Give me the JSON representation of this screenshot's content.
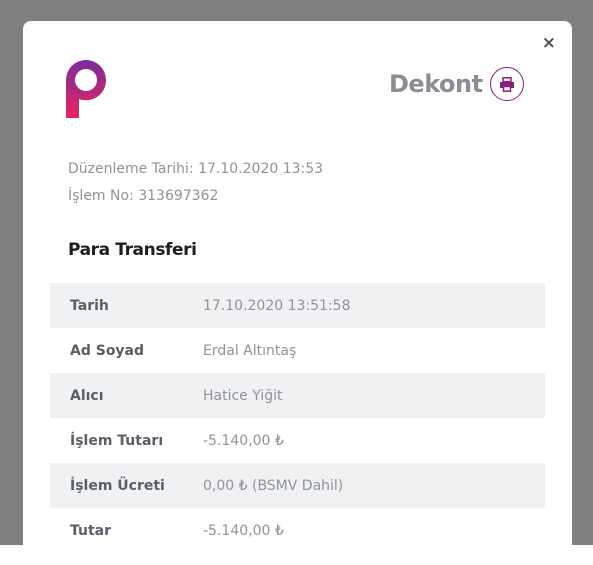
{
  "modal": {
    "close_label": "×",
    "title": "Dekont",
    "brand_color": "#8a1d7a"
  },
  "meta": [
    {
      "label": "Düzenleme Tarihi:",
      "value": "17.10.2020 13:53"
    },
    {
      "label": "İşlem No:",
      "value": "313697362"
    }
  ],
  "section_title": "Para Transferi",
  "rows": [
    {
      "label": "Tarih",
      "value": "17.10.2020 13:51:58"
    },
    {
      "label": "Ad Soyad",
      "value": "Erdal Altıntaş"
    },
    {
      "label": "Alıcı",
      "value": "Hatice Yiğit"
    },
    {
      "label": "İşlem Tutarı",
      "value": "-5.140,00 ₺"
    },
    {
      "label": "İşlem Ücreti",
      "value": "0,00 ₺ (BSMV Dahil)"
    },
    {
      "label": "Tutar",
      "value": "-5.140,00 ₺"
    }
  ]
}
